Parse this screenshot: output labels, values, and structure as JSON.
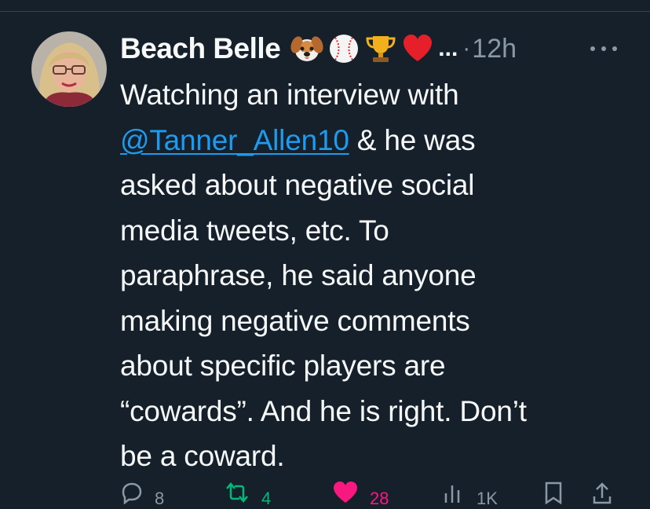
{
  "tweet": {
    "author_name": "Beach Belle",
    "name_emojis": [
      "dog-face",
      "baseball",
      "trophy",
      "red-heart"
    ],
    "truncation": "...",
    "separator": "·",
    "timestamp": "12h",
    "text_lines": [
      "Watching an interview with",
      "@Tanner_Allen10",
      " & he was",
      "asked about negative social",
      "media tweets, etc. To",
      "paraphrase, he said anyone",
      "making negative comments",
      "about specific players are",
      "“cowards”. And he is right. Don’t",
      "be a coward."
    ],
    "actions": {
      "reply": {
        "icon": "reply-icon",
        "count": "8"
      },
      "retweet": {
        "icon": "retweet-icon",
        "count": "4"
      },
      "like": {
        "icon": "heart-icon",
        "count": "28"
      },
      "views": {
        "icon": "views-icon",
        "count": "1K"
      },
      "bookmark": {
        "icon": "bookmark-icon"
      },
      "share": {
        "icon": "share-icon"
      }
    }
  },
  "colors": {
    "background": "#15202b",
    "text": "#f7f9f9",
    "secondary": "#8b98a5",
    "link": "#1d9bf0",
    "retweet": "#00ba7c",
    "like": "#f91880"
  }
}
